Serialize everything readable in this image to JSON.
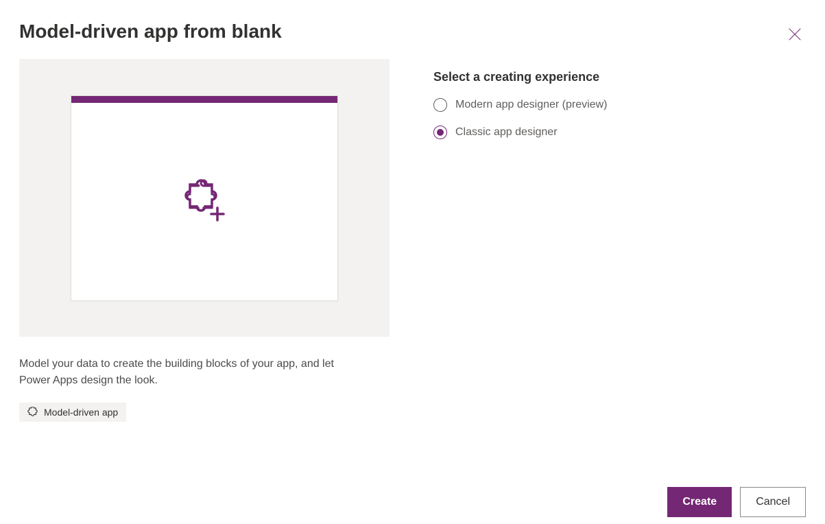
{
  "dialog": {
    "title": "Model-driven app from blank",
    "description": "Model your data to create the building blocks of your app, and let Power Apps design the look.",
    "tag_label": "Model-driven app"
  },
  "options": {
    "section_label": "Select a creating experience",
    "items": [
      {
        "label": "Modern app designer (preview)",
        "selected": false
      },
      {
        "label": "Classic app designer",
        "selected": true
      }
    ]
  },
  "footer": {
    "create_label": "Create",
    "cancel_label": "Cancel"
  }
}
